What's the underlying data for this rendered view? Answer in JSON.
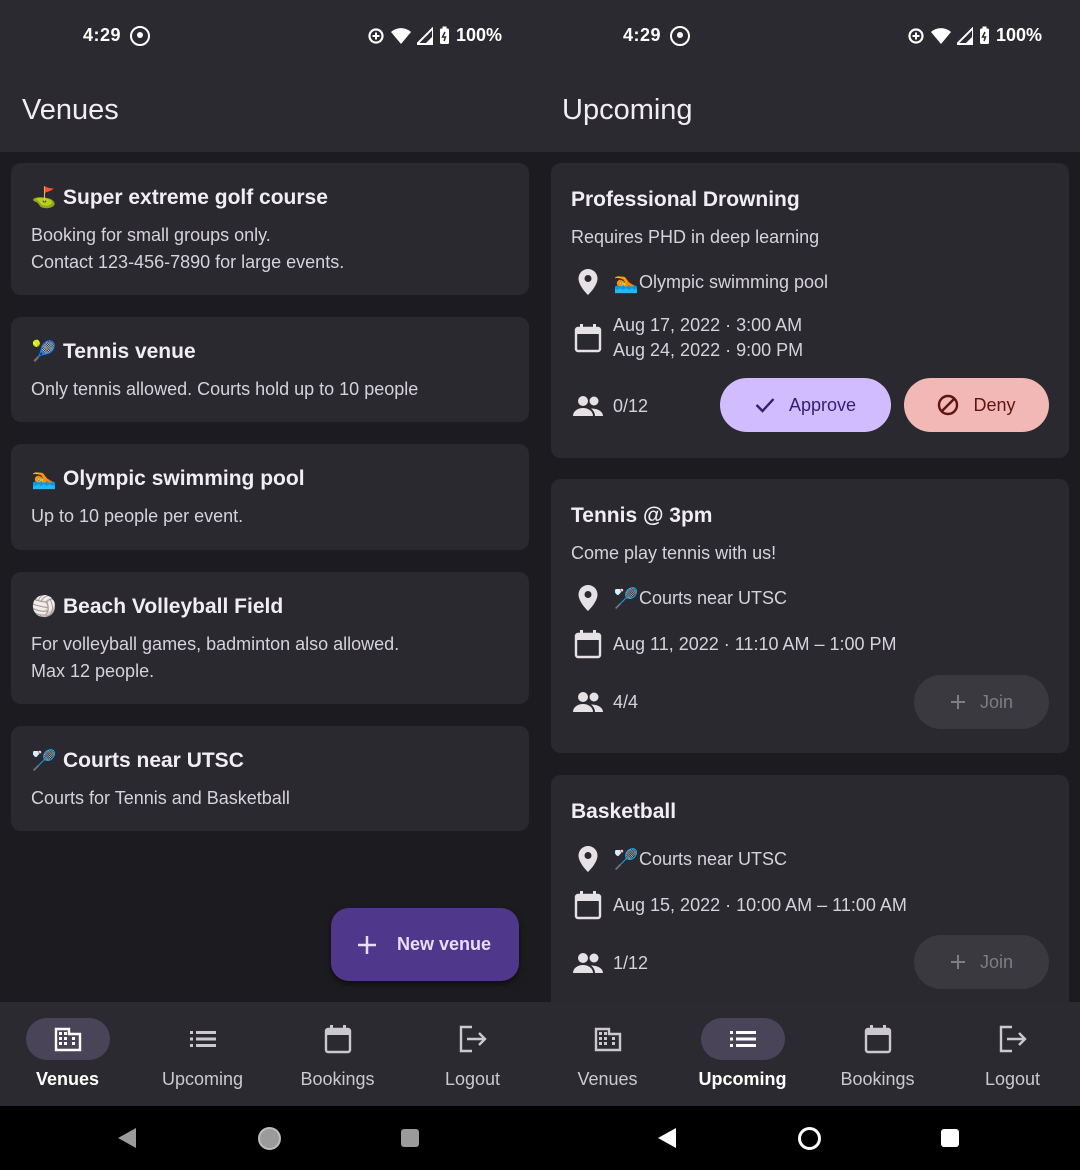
{
  "status_bar": {
    "time": "4:29",
    "battery": "100%"
  },
  "left_screen": {
    "title": "Venues",
    "venues": [
      {
        "emoji": "⛳",
        "emoji_name": "golf-flag-icon",
        "name": "Super extreme golf course",
        "description": "Booking for small groups only.\nContact 123-456-7890 for large events."
      },
      {
        "emoji": "🎾",
        "emoji_name": "tennis-ball-icon",
        "name": "Tennis venue",
        "description": "Only tennis allowed. Courts hold up to 10 people"
      },
      {
        "emoji": "🏊",
        "emoji_name": "swimmer-icon",
        "name": "Olympic swimming pool",
        "description": "Up to 10 people per event."
      },
      {
        "emoji": "🏐",
        "emoji_name": "volleyball-icon",
        "name": "Beach Volleyball Field",
        "description": "For volleyball games, badminton also allowed.\nMax 12 people."
      },
      {
        "emoji": "🏸",
        "emoji_name": "badminton-icon",
        "name": "Courts near UTSC",
        "description": "Courts for Tennis and Basketball"
      }
    ],
    "fab_label": "New venue",
    "active_tab": "Venues"
  },
  "right_screen": {
    "title": "Upcoming",
    "events": [
      {
        "name": "Professional Drowning",
        "subtitle": "Requires PHD in deep learning",
        "venue_emoji": "🏊",
        "venue": "Olympic swimming pool",
        "date_start": "Aug 17, 2022 · 3:00 AM",
        "date_end": "Aug 24, 2022 · 9:00 PM",
        "attendance": "0/12",
        "approve_label": "Approve",
        "deny_label": "Deny"
      },
      {
        "name": "Tennis @ 3pm",
        "subtitle": "Come play tennis with us!",
        "venue_emoji": "🏸",
        "venue": "Courts near UTSC",
        "date": "Aug 11, 2022 · 11:10 AM – 1:00 PM",
        "attendance": "4/4",
        "join_label": "Join"
      },
      {
        "name": "Basketball",
        "venue_emoji": "🏸",
        "venue": "Courts near UTSC",
        "date": "Aug 15, 2022 · 10:00 AM – 11:00 AM",
        "attendance": "1/12",
        "join_label": "Join"
      }
    ],
    "active_tab": "Upcoming"
  },
  "bottom_nav": {
    "items": [
      {
        "label": "Venues",
        "icon": "building-icon"
      },
      {
        "label": "Upcoming",
        "icon": "list-icon"
      },
      {
        "label": "Bookings",
        "icon": "calendar-icon"
      },
      {
        "label": "Logout",
        "icon": "logout-icon"
      }
    ]
  },
  "colors": {
    "background": "#1c1b1f",
    "surface": "#2a2930",
    "primary_container": "#4f378b",
    "approve": "#d0bcff",
    "deny": "#f2b8b5"
  }
}
